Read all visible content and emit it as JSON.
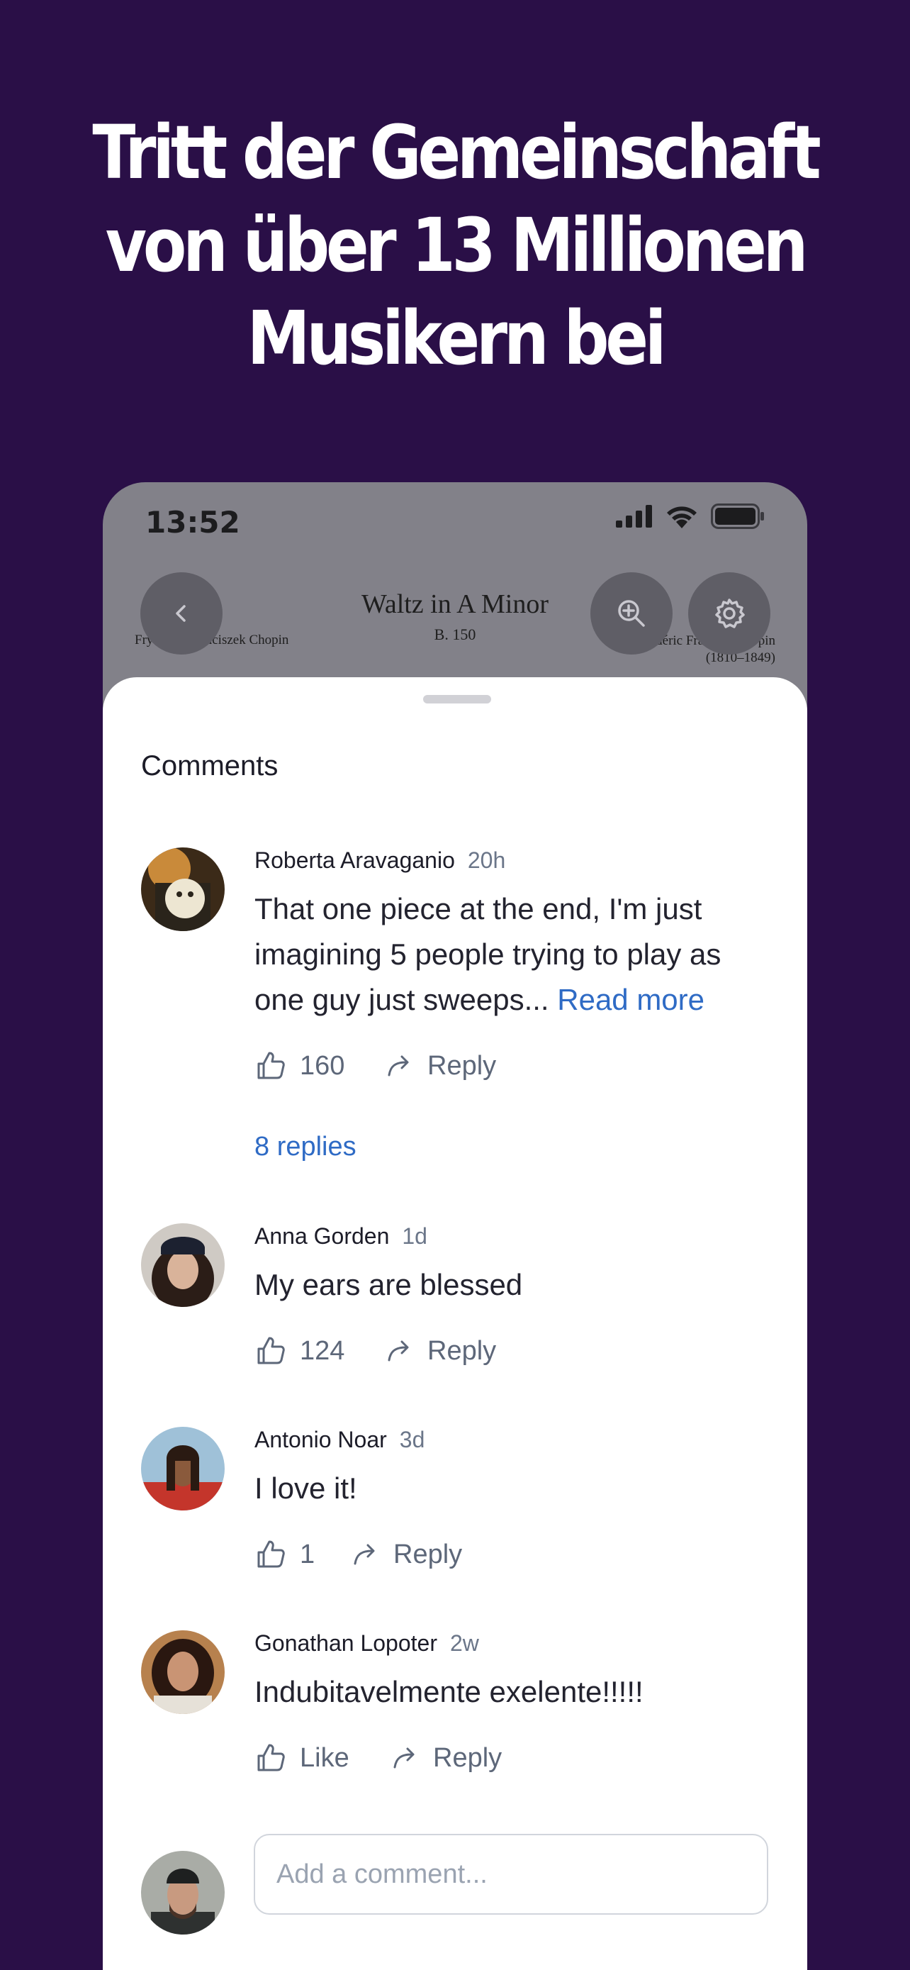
{
  "headline": {
    "line1": "Tritt der Gemeinschaft",
    "line2": "von über 13 Millionen",
    "line3": "Musikern bei"
  },
  "status_bar": {
    "time": "13:52",
    "icons": [
      "signal-icon",
      "wifi-icon",
      "battery-icon"
    ]
  },
  "score": {
    "title": "Waltz in A Minor",
    "subtitle": "B. 150",
    "composer_left": "Fryderyk Franciszek Chopin",
    "composer_right_line1": "Frédéric François Chopin",
    "composer_right_line2": "(1810–1849)"
  },
  "toolbar": {
    "back_icon": "chevron-left-icon",
    "zoom_icon": "zoom-in-icon",
    "settings_icon": "gear-icon"
  },
  "comments_sheet": {
    "title": "Comments",
    "comments": [
      {
        "author": "Roberta Aravaganio",
        "time": "20h",
        "text": "That one piece at the end, I'm just imagining 5 people trying to play as one guy just sweeps...",
        "read_more": "Read more",
        "likes": "160",
        "reply_label": "Reply",
        "replies_link": "8 replies"
      },
      {
        "author": "Anna Gorden",
        "time": "1d",
        "text": "My ears are blessed",
        "likes": "124",
        "reply_label": "Reply"
      },
      {
        "author": "Antonio Noar",
        "time": "3d",
        "text": "I love it!",
        "likes": "1",
        "reply_label": "Reply"
      },
      {
        "author": "Gonathan Lopoter",
        "time": "2w",
        "text": "Indubitavelmente exelente!!!!!",
        "likes": "Like",
        "reply_label": "Reply"
      }
    ],
    "add_comment": {
      "placeholder": "Add a comment..."
    }
  },
  "colors": {
    "background": "#2a0f47",
    "link": "#2f6bc5",
    "muted": "#6b7689"
  }
}
